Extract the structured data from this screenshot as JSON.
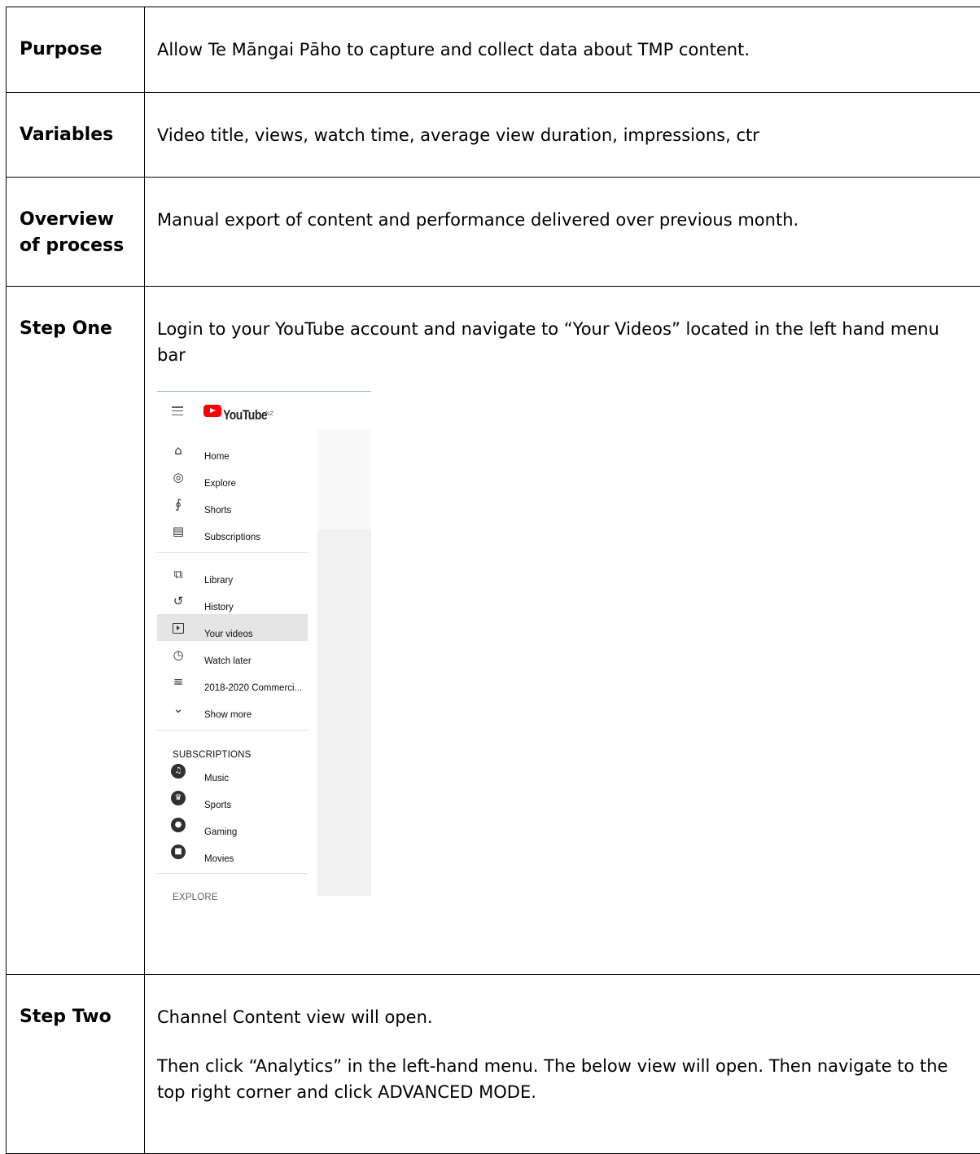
{
  "rows": [
    {
      "label_lines": [
        "Purpose"
      ],
      "text": "Allow Te Māngai Pāho to capture and collect data about TMP content."
    },
    {
      "label_lines": [
        "Variables"
      ],
      "text": "Video title, views, watch time, average view duration, impressions, ctr"
    },
    {
      "label_lines": [
        "Overview",
        "of process"
      ],
      "text": "Manual export of content and performance delivered over previous month."
    },
    {
      "label_lines": [
        "Step One"
      ],
      "text": "Login to your YouTube account and navigate to “Your Videos” located in the left hand menu bar"
    },
    {
      "label_lines": [
        "Step Two"
      ],
      "paragraphs": [
        "Channel Content view will open.",
        "Then click “Analytics” in the left-hand menu. The below view will open. Then navigate to the top right corner and click ADVANCED MODE."
      ]
    }
  ],
  "youtube": {
    "brand": "YouTube",
    "region": "NZ",
    "primary_menu": [
      {
        "icon": "home-icon",
        "label": "Home"
      },
      {
        "icon": "explore-icon",
        "label": "Explore"
      },
      {
        "icon": "shorts-icon",
        "label": "Shorts"
      },
      {
        "icon": "subscriptions-icon",
        "label": "Subscriptions"
      }
    ],
    "secondary_menu": [
      {
        "icon": "library-icon",
        "label": "Library"
      },
      {
        "icon": "history-icon",
        "label": "History"
      },
      {
        "icon": "your-videos-icon",
        "label": "Your videos",
        "active": true
      },
      {
        "icon": "watch-later-icon",
        "label": "Watch later"
      },
      {
        "icon": "playlist-icon",
        "label": "2018-2020 Commerci..."
      },
      {
        "icon": "chevron-down-icon",
        "label": "Show more"
      }
    ],
    "subscriptions_heading": "SUBSCRIPTIONS",
    "subscriptions": [
      {
        "icon": "music-icon",
        "label": "Music"
      },
      {
        "icon": "sports-icon",
        "label": "Sports"
      },
      {
        "icon": "gaming-icon",
        "label": "Gaming"
      },
      {
        "icon": "movies-icon",
        "label": "Movies"
      }
    ],
    "explore_heading": "EXPLORE"
  }
}
